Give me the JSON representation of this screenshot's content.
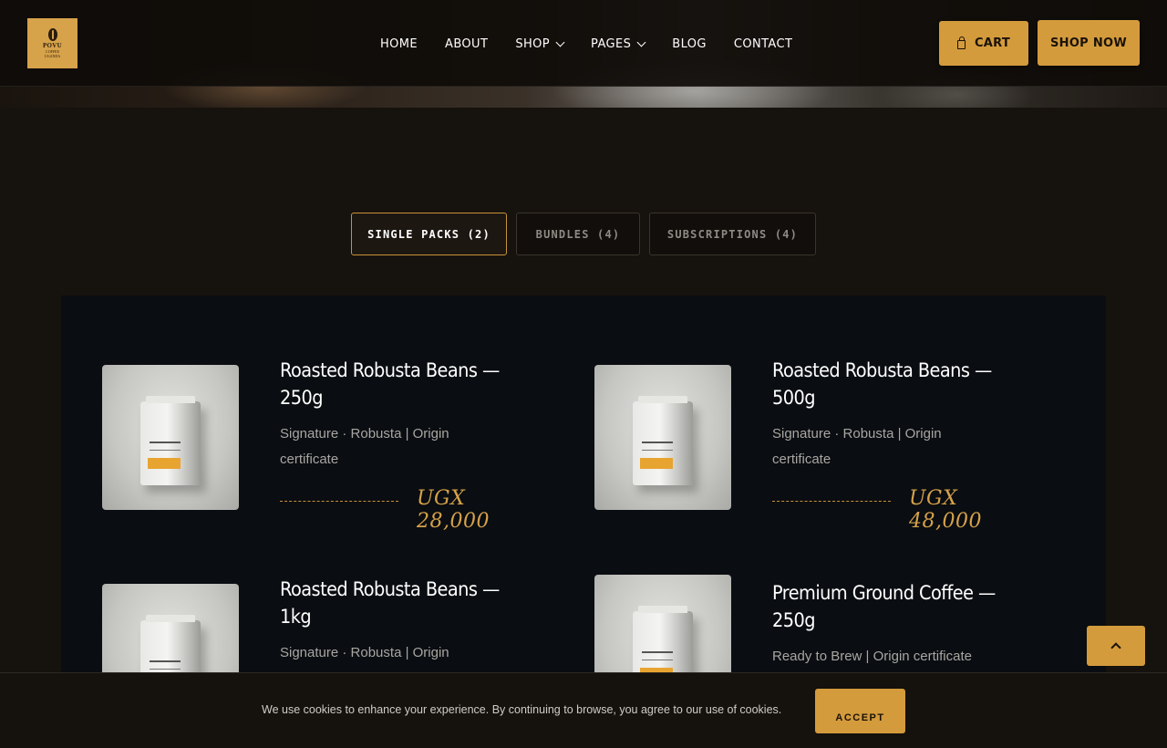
{
  "header": {
    "logo": {
      "brand": "POVU",
      "sub1": "COFFEE",
      "sub2": "UGANDA"
    },
    "nav": [
      {
        "label": "HOME",
        "has_dropdown": false
      },
      {
        "label": "ABOUT",
        "has_dropdown": false
      },
      {
        "label": "SHOP",
        "has_dropdown": true
      },
      {
        "label": "PAGES",
        "has_dropdown": true
      },
      {
        "label": "BLOG",
        "has_dropdown": false
      },
      {
        "label": "CONTACT",
        "has_dropdown": false
      }
    ],
    "cart_label": "CART",
    "shop_now_label": "SHOP NOW"
  },
  "tabs": [
    {
      "label": "SINGLE PACKS (2)",
      "active": true
    },
    {
      "label": "BUNDLES (4)",
      "active": false
    },
    {
      "label": "SUBSCRIPTIONS (4)",
      "active": false
    }
  ],
  "products": [
    {
      "title": "Roasted Robusta Beans — 250g",
      "meta": "Signature · Robusta | Origin certificate",
      "price": "UGX 28,000"
    },
    {
      "title": "Roasted Robusta Beans — 500g",
      "meta": "Signature · Robusta | Origin certificate",
      "price": "UGX 48,000"
    },
    {
      "title": "Roasted Robusta Beans — 1kg",
      "meta": "Signature · Robusta | Origin",
      "price": ""
    },
    {
      "title": "Premium Ground Coffee — 250g",
      "meta": "Ready to Brew | Origin certificate",
      "price": ""
    }
  ],
  "cookie": {
    "text": "We use cookies to enhance your experience. By continuing to browse, you agree to our use of cookies.",
    "accept_label": "ACCEPT"
  },
  "colors": {
    "accent": "#d49b3c",
    "page_bg": "#16120d",
    "panel_bg": "#0a0d11",
    "price": "#d6a24a"
  }
}
